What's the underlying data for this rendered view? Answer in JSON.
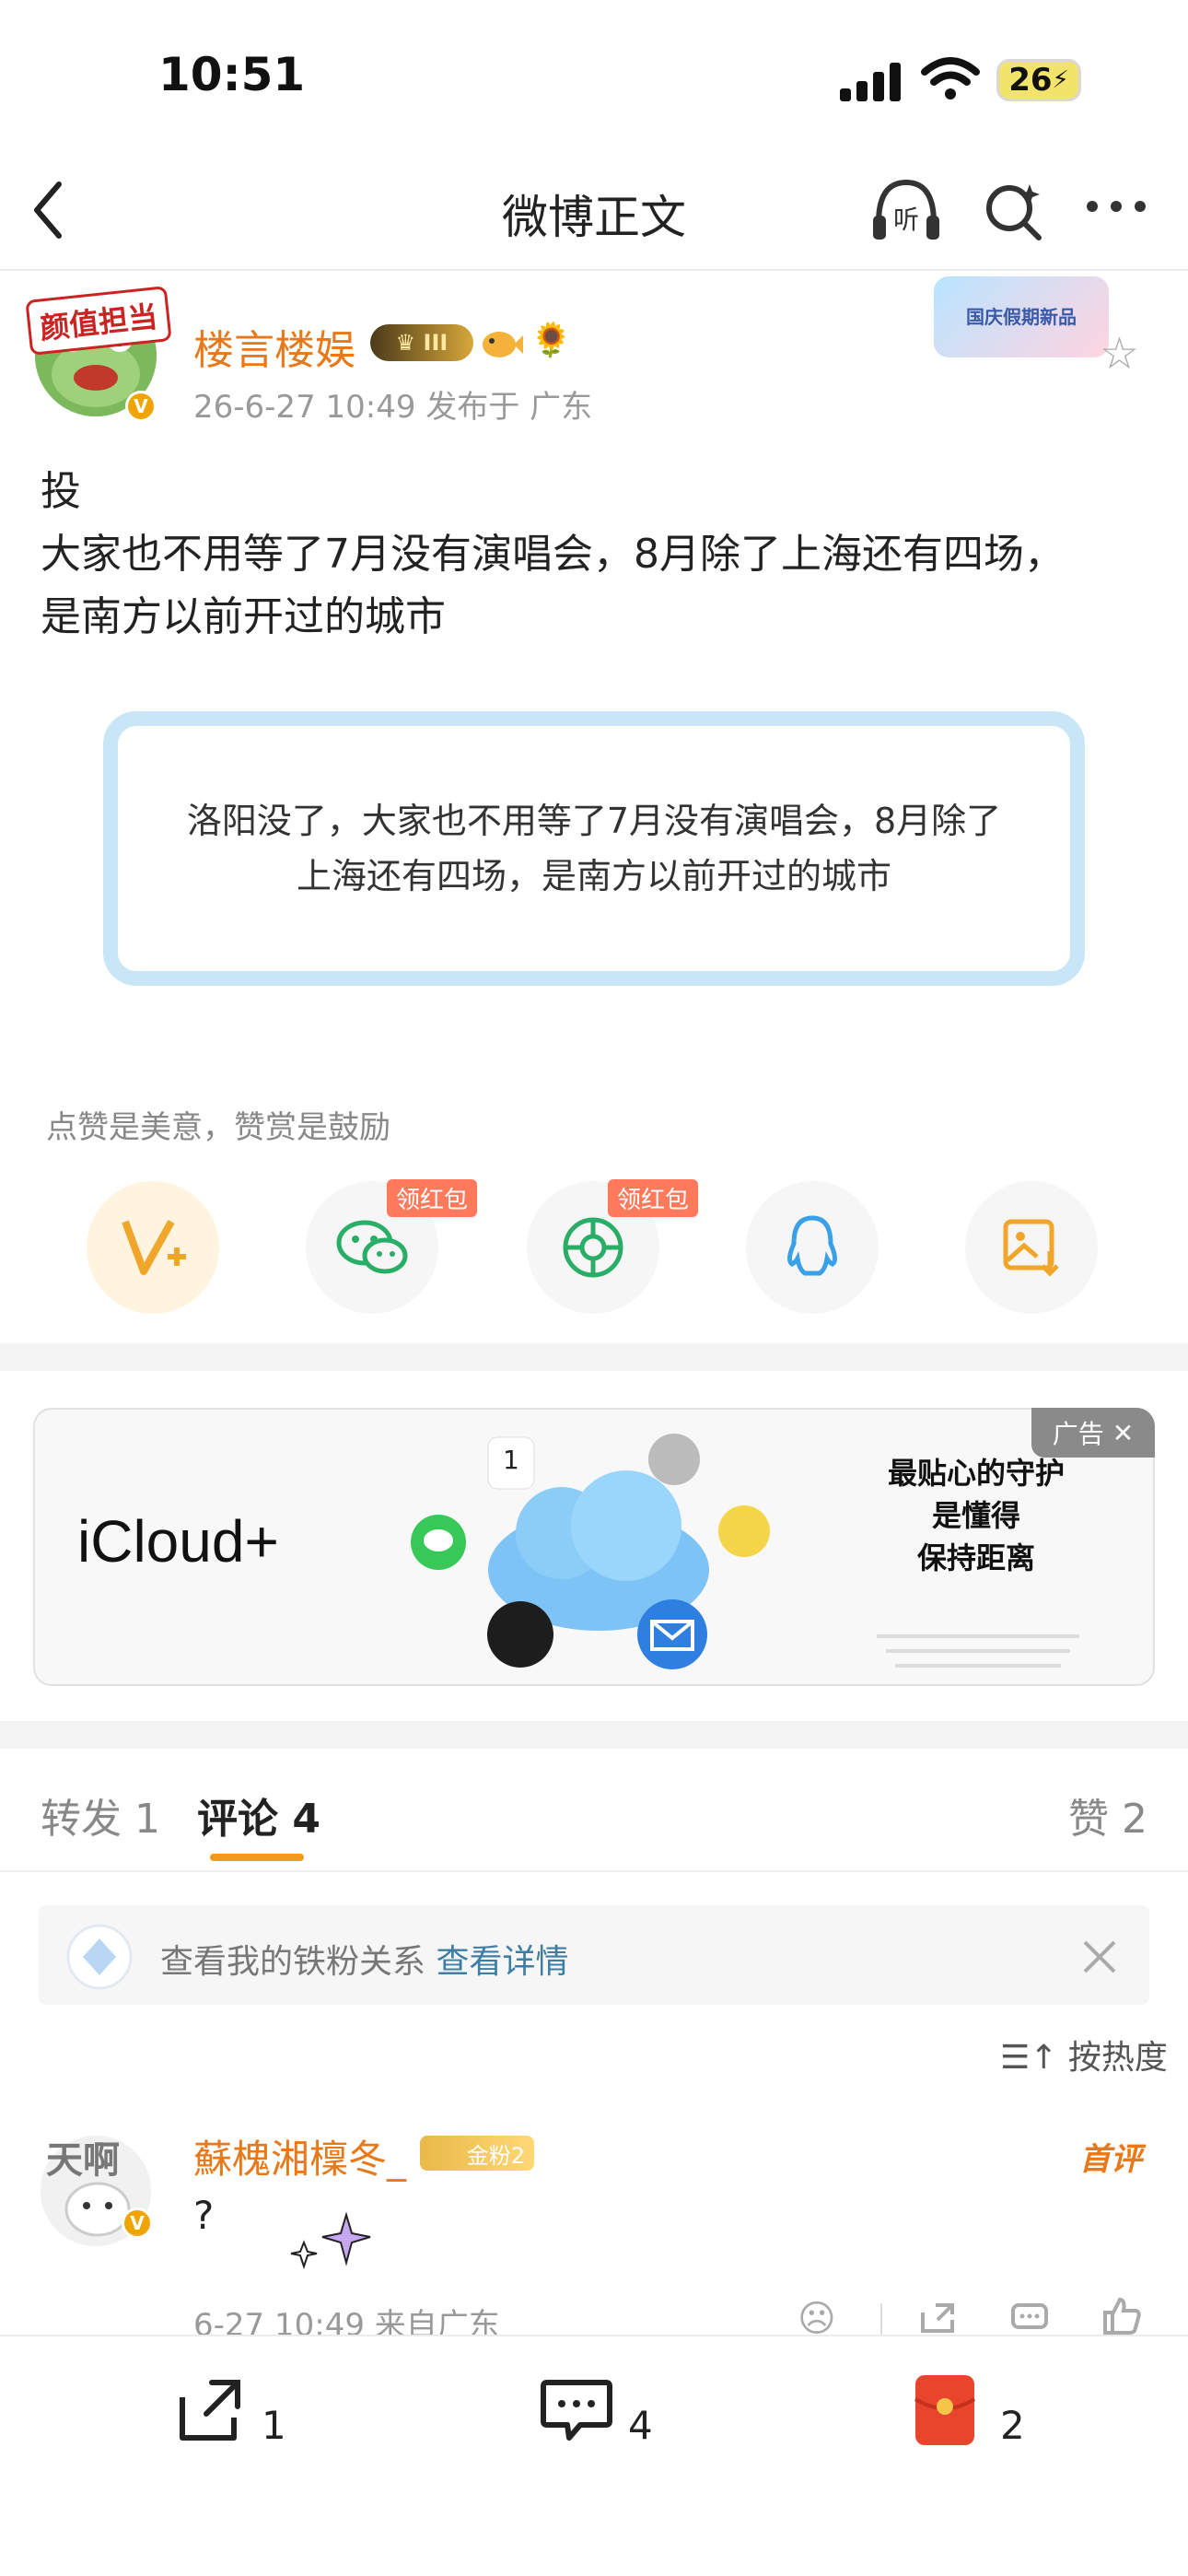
{
  "status_bar": {
    "time": "10:51",
    "battery": "26"
  },
  "nav": {
    "title": "微博正文"
  },
  "post": {
    "avatar_tag": "颜值担当",
    "username": "楼言楼娱",
    "crown_level": "III",
    "meta": "26-6-27 10:49  发布于 广东",
    "festival_badge": "国庆假期新品",
    "text": "投\n大家也不用等了7月没有演唱会，8月除了上海还有四场，\n是南方以前开过的城市",
    "quote": "洛阳没了，大家也不用等了7月没有演唱会，8月除了上海还有四场，是南方以前开过的城市",
    "tip": "点赞是美意，赞赏是鼓励"
  },
  "share": {
    "red_tag_1": "领红包",
    "red_tag_2": "领红包"
  },
  "ad": {
    "brand": "iCloud+",
    "tag": "广告",
    "copy_line1": "最贴心的守护",
    "copy_line2": "是懂得",
    "copy_line3": "保持距离",
    "calendar_day": "1"
  },
  "tabs": {
    "repost": "转发 1",
    "comments": "评论 4",
    "likes": "赞 2"
  },
  "fans": {
    "text": "查看我的铁粉关系 ",
    "link": "查看详情"
  },
  "sort": {
    "label": "按热度"
  },
  "comment": {
    "avatar_text": "天啊",
    "name": "蘇槐湘檁冬_",
    "badge": "金粉2",
    "first_label": "首评",
    "text": "?",
    "meta": "6-27 10:49  来自广东"
  },
  "bottom": {
    "repost_count": "1",
    "comment_count": "4",
    "like_count": "2"
  },
  "colors": {
    "orange": "#e8791a",
    "link": "#3e7ea5",
    "accent_underline": "#f39a1c",
    "quote_border": "#c9e6f6"
  }
}
